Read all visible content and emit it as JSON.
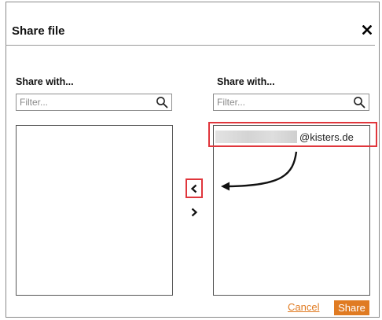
{
  "dialog": {
    "title": "Share file",
    "close_icon": "close-icon"
  },
  "left": {
    "label": "Share with...",
    "filter_placeholder": "Filter...",
    "items": []
  },
  "right": {
    "label": "Share with...",
    "filter_placeholder": "Filter...",
    "items": [
      {
        "name_redacted": true,
        "domain": "@kisters.de"
      }
    ]
  },
  "move_buttons": {
    "move_left_icon": "chevron-left-icon",
    "move_right_icon": "chevron-right-icon"
  },
  "footer": {
    "cancel_label": "Cancel",
    "share_label": "Share"
  },
  "colors": {
    "accent": "#e07b22",
    "annotation_red": "#e0363c"
  }
}
